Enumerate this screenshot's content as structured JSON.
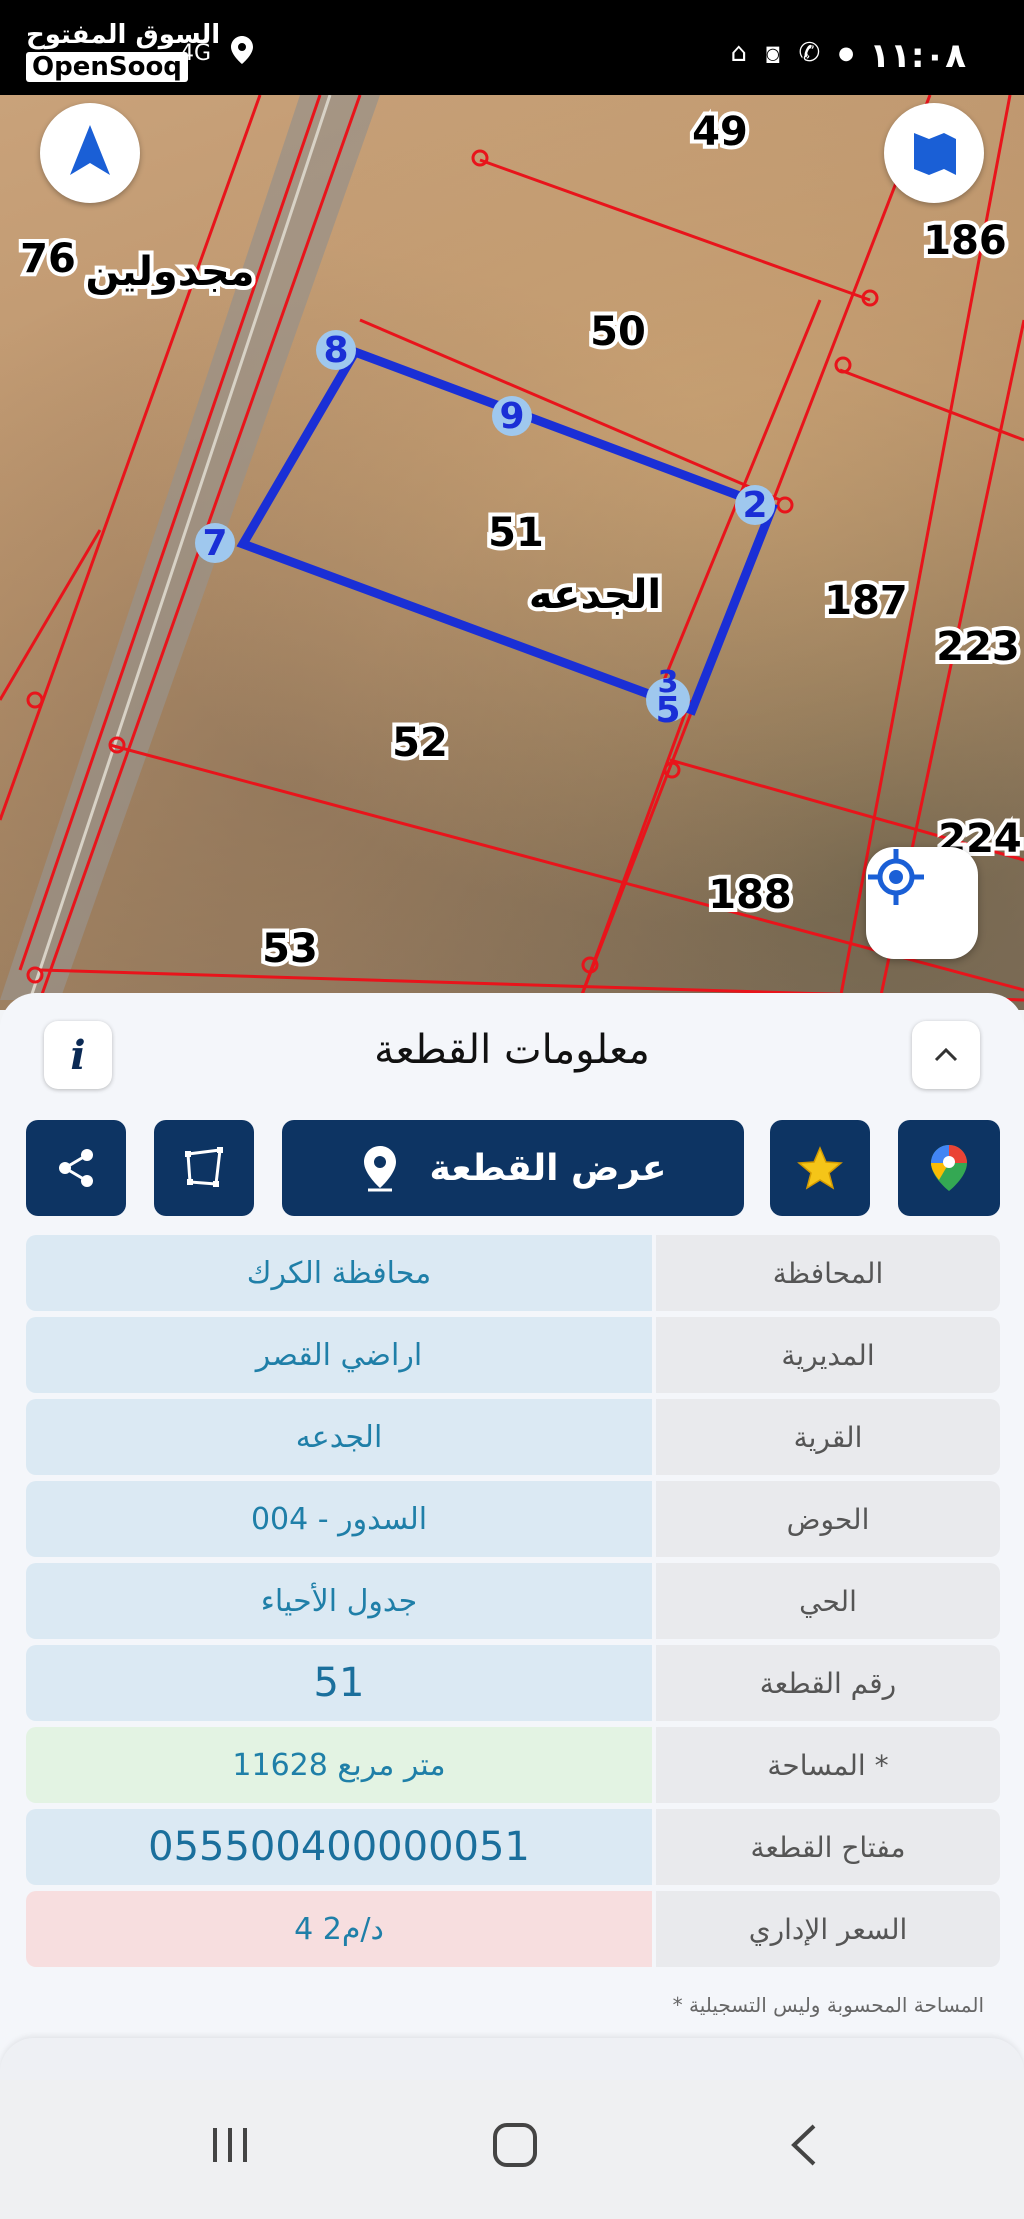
{
  "status_bar": {
    "time": "١١:٠٨",
    "network": "4G"
  },
  "watermark": {
    "brand_ar": "السوق المفتوح",
    "brand_en": "OpenSooq"
  },
  "map": {
    "village_label": "الجدعه",
    "area_label": "مجدولين",
    "parcel_numbers": [
      "76",
      "49",
      "50",
      "186",
      "51",
      "187",
      "223",
      "52",
      "224",
      "188",
      "53"
    ],
    "boundary_points": [
      "8",
      "9",
      "2",
      "7",
      "5",
      "3"
    ],
    "boundary_color": "#1a2fd6",
    "parcel_line_color": "#e8141b"
  },
  "panel": {
    "title": "معلومات القطعة",
    "show_parcel_label": "عرض القطعة",
    "rows": [
      {
        "label": "المحافظة",
        "value": "محافظة الكرك"
      },
      {
        "label": "المديرية",
        "value": "اراضي القصر"
      },
      {
        "label": "القرية",
        "value": "الجدعه"
      },
      {
        "label": "الحوض",
        "value": "السدور - 004"
      },
      {
        "label": "الحي",
        "value": "جدول الأحياء"
      },
      {
        "label": "رقم القطعة",
        "value": "51"
      },
      {
        "label": "المساحة *",
        "value": "11628   متر مربع"
      },
      {
        "label": "مفتاح القطعة",
        "value": "055500400000051"
      },
      {
        "label": "السعر الإداري",
        "value": "4 د/م2"
      }
    ],
    "footnote": "* المساحة المحسوبة وليس التسجيلية"
  },
  "colors": {
    "primary": "#0d3463",
    "value_text": "#1f7fa8",
    "star": "#f5c518"
  }
}
